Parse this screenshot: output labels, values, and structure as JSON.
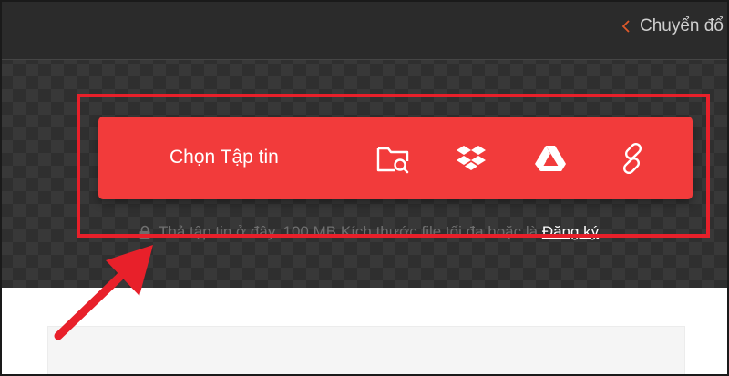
{
  "header": {
    "breadcrumb_text": "Chuyển đổ"
  },
  "uploader": {
    "choose_file_label": "Chọn Tập tin",
    "sources": [
      {
        "name": "folder-search-icon"
      },
      {
        "name": "dropbox-icon"
      },
      {
        "name": "google-drive-icon"
      },
      {
        "name": "link-icon"
      }
    ],
    "note_text": "Thả tập tin ở đây. 100 MB Kích thước file tối đa hoặc là",
    "signup_link": "Đăng ký",
    "note_end": "."
  },
  "colors": {
    "accent": "#f23b3b",
    "highlight": "#e8202a",
    "dark_bg": "#2f2f2f"
  }
}
